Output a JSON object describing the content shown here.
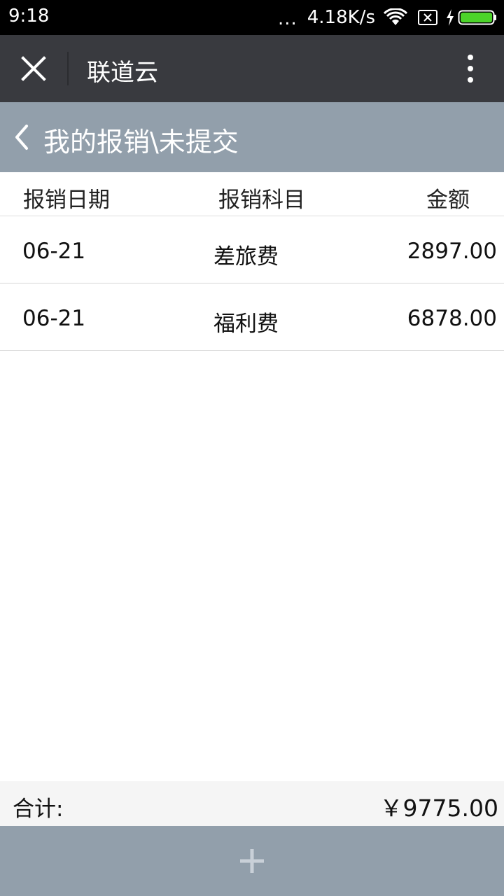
{
  "status_bar": {
    "time": "9:18",
    "dots": "...",
    "net_speed": "4.18K/s",
    "icons": [
      "wifi-icon",
      "sim-none-icon",
      "charging-icon",
      "battery-icon"
    ],
    "battery_color": "#4cd42a"
  },
  "title_bar": {
    "title": "联道云",
    "icons": [
      "close-icon",
      "more-vertical-icon"
    ],
    "background": "#393a3f"
  },
  "nav_bar": {
    "title": "我的报销\\未提交",
    "icon": "chevron-left-icon",
    "background": "#929fab"
  },
  "table": {
    "headers": {
      "date": "报销日期",
      "subject": "报销科目",
      "amount": "金额"
    },
    "rows": [
      {
        "date": "06-21",
        "subject": "差旅费",
        "amount": "2897.00"
      },
      {
        "date": "06-21",
        "subject": "福利费",
        "amount": "6878.00"
      }
    ]
  },
  "total": {
    "label": "合计:",
    "value": "￥9775.00"
  },
  "footer": {
    "icon": "plus-icon",
    "background": "#929fab"
  }
}
